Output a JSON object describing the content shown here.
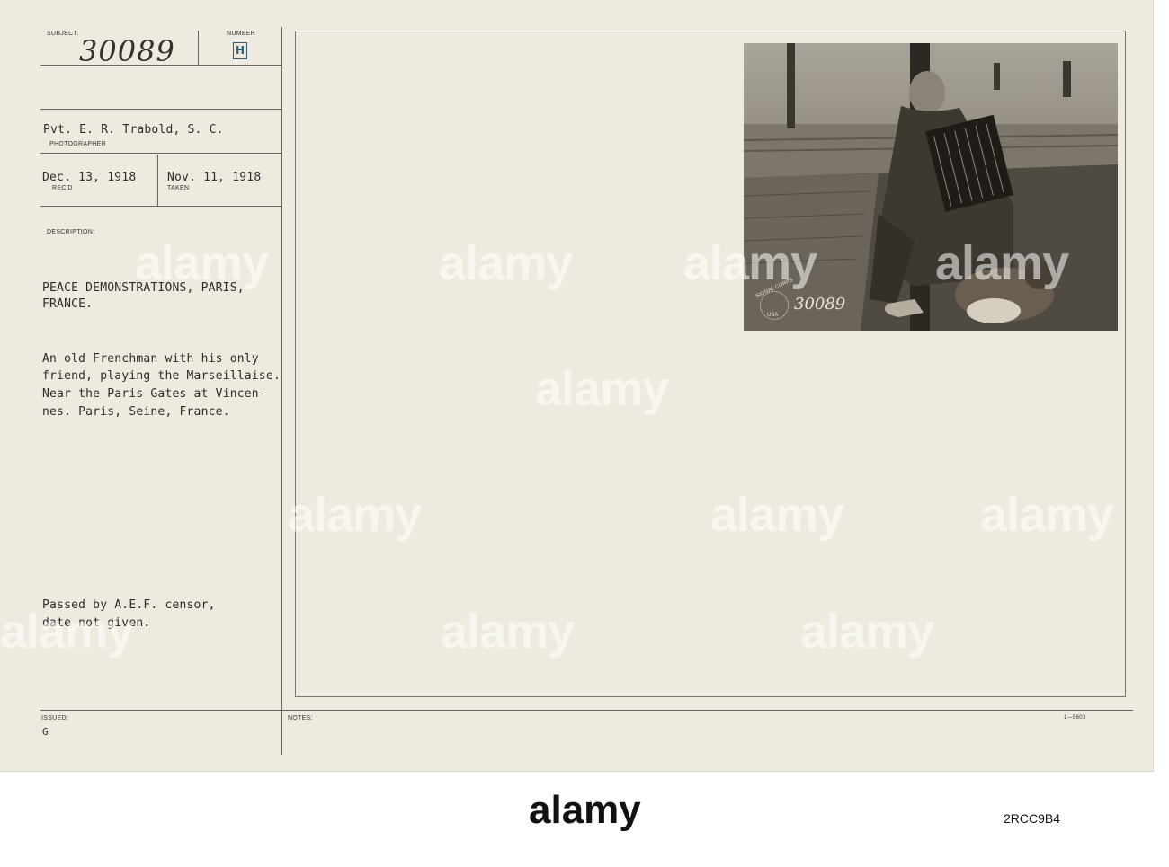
{
  "card": {
    "subject_label": "SUBJECT:",
    "subject_number": "30089",
    "number_label": "NUMBER",
    "number_letter": "H",
    "photographer_name": "Pvt. E. R. Trabold, S. C.",
    "photographer_label": "PHOTOGRAPHER",
    "received_date": "Dec. 13, 1918",
    "received_label": "REC'D",
    "taken_date": "Nov. 11, 1918",
    "taken_label": "TAKEN",
    "description_label": "DESCRIPTION:",
    "description_lines": [
      "PEACE DEMONSTRATIONS, PARIS,",
      "FRANCE.",
      "An old Frenchman with his only",
      "friend, playing the Marseillaise.",
      "Near the Paris Gates at Vincen-",
      "nes. Paris, Seine, France."
    ],
    "censor_lines": [
      "Passed by A.E.F. censor,",
      "date not given."
    ],
    "issued_label": "ISSUED:",
    "issued_value": "G",
    "notes_label": "NOTES:",
    "form_code": "1—5603"
  },
  "photo": {
    "stamp_text": "SIGNAL CORPS",
    "stamp_sub": "USA",
    "photo_number": "30089"
  },
  "watermark": "alamy",
  "footer": {
    "logo": "alamy",
    "image_id": "2RCC9B4"
  }
}
